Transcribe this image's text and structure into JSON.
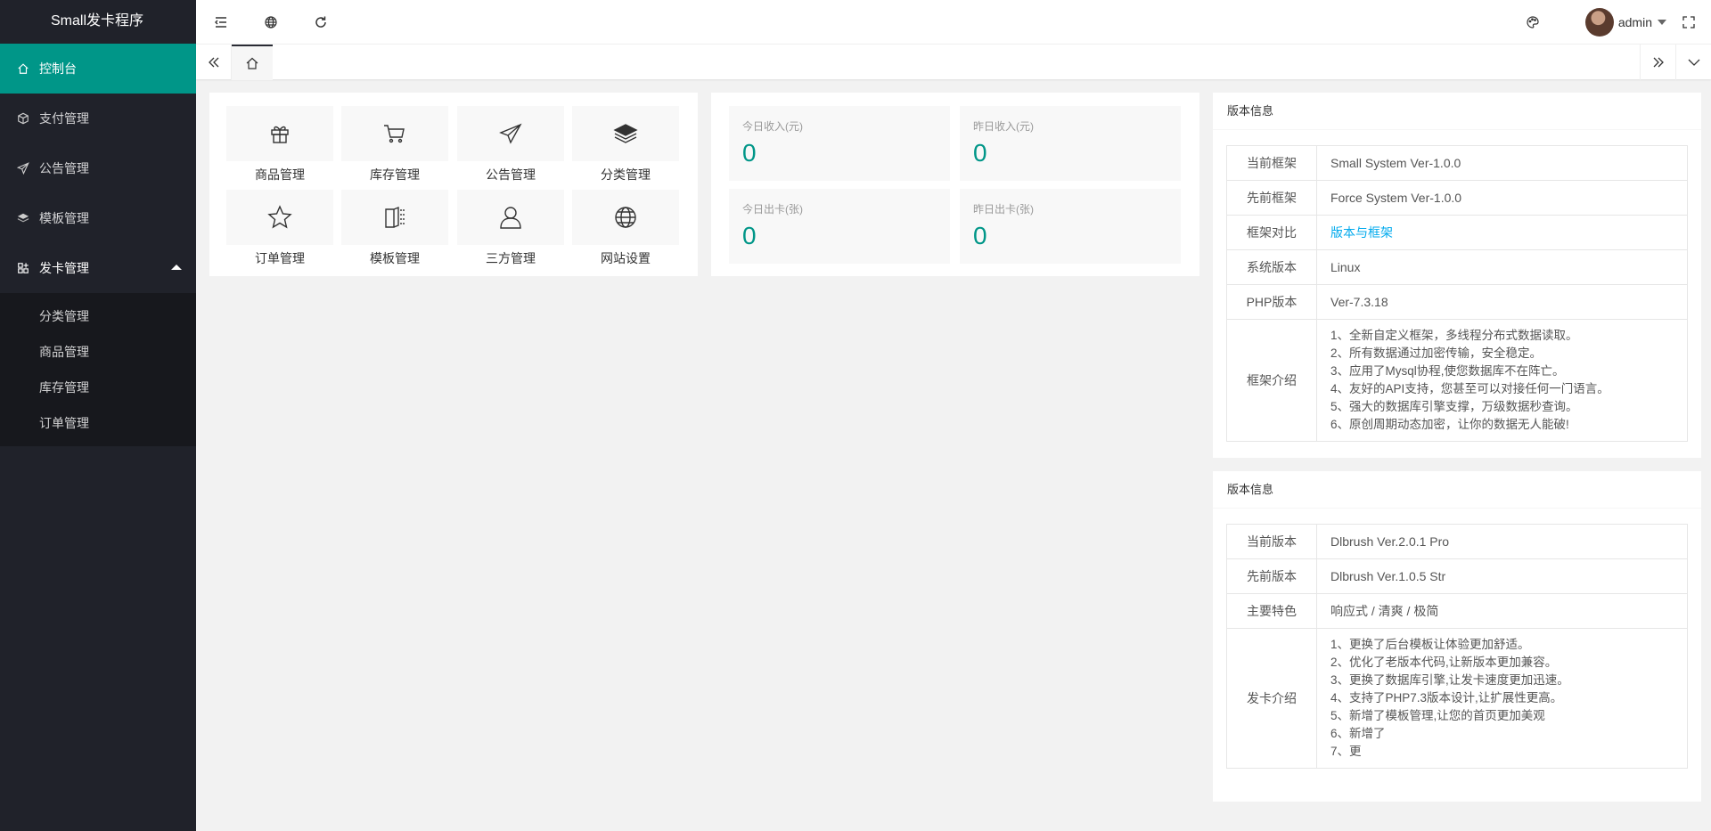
{
  "app": {
    "title": "Small发卡程序"
  },
  "sidebar": {
    "items": [
      {
        "label": "控制台"
      },
      {
        "label": "支付管理"
      },
      {
        "label": "公告管理"
      },
      {
        "label": "模板管理"
      },
      {
        "label": "发卡管理"
      }
    ],
    "submenu": [
      {
        "label": "分类管理"
      },
      {
        "label": "商品管理"
      },
      {
        "label": "库存管理"
      },
      {
        "label": "订单管理"
      }
    ]
  },
  "header": {
    "user": "admin"
  },
  "shortcuts": [
    {
      "label": "商品管理",
      "icon": "gift-icon"
    },
    {
      "label": "库存管理",
      "icon": "cart-icon"
    },
    {
      "label": "公告管理",
      "icon": "send-icon"
    },
    {
      "label": "分类管理",
      "icon": "layers-icon"
    },
    {
      "label": "订单管理",
      "icon": "star-icon"
    },
    {
      "label": "模板管理",
      "icon": "template-icon"
    },
    {
      "label": "三方管理",
      "icon": "user-icon"
    },
    {
      "label": "网站设置",
      "icon": "globe-icon"
    }
  ],
  "stats": [
    {
      "label": "今日收入(元)",
      "value": "0"
    },
    {
      "label": "昨日收入(元)",
      "value": "0"
    },
    {
      "label": "今日出卡(张)",
      "value": "0"
    },
    {
      "label": "昨日出卡(张)",
      "value": "0"
    }
  ],
  "panel1": {
    "title": "版本信息",
    "rows": [
      {
        "key": "当前框架",
        "value": "Small System Ver-1.0.0"
      },
      {
        "key": "先前框架",
        "value": "Force System Ver-1.0.0"
      },
      {
        "key": "框架对比",
        "value": "版本与框架"
      },
      {
        "key": "系统版本",
        "value": "Linux"
      },
      {
        "key": "PHP版本",
        "value": "Ver-7.3.18"
      }
    ],
    "intro_key": "框架介绍",
    "intro": [
      "1、全新自定义框架，多线程分布式数据读取。",
      "2、所有数据通过加密传输，安全稳定。",
      "3、应用了Mysql协程,使您数据库不在阵亡。",
      "4、友好的API支持，您甚至可以对接任何一门语言。",
      "5、强大的数据库引擎支撑，万级数据秒查询。",
      "6、原创周期动态加密，让你的数据无人能破!"
    ]
  },
  "panel2": {
    "title": "版本信息",
    "rows": [
      {
        "key": "当前版本",
        "value": "Dlbrush Ver.2.0.1 Pro"
      },
      {
        "key": "先前版本",
        "value": "Dlbrush Ver.1.0.5 Str"
      },
      {
        "key": "主要特色",
        "value": "响应式 / 清爽 / 极简"
      }
    ],
    "intro_key": "发卡介绍",
    "intro": [
      "1、更换了后台模板让体验更加舒适。",
      "2、优化了老版本代码,让新版本更加兼容。",
      "3、更换了数据库引擎,让发卡速度更加迅速。",
      "4、支持了PHP7.3版本设计,让扩展性更高。",
      "5、新增了模板管理,让您的首页更加美观",
      "6、新增了",
      "7、更"
    ]
  }
}
